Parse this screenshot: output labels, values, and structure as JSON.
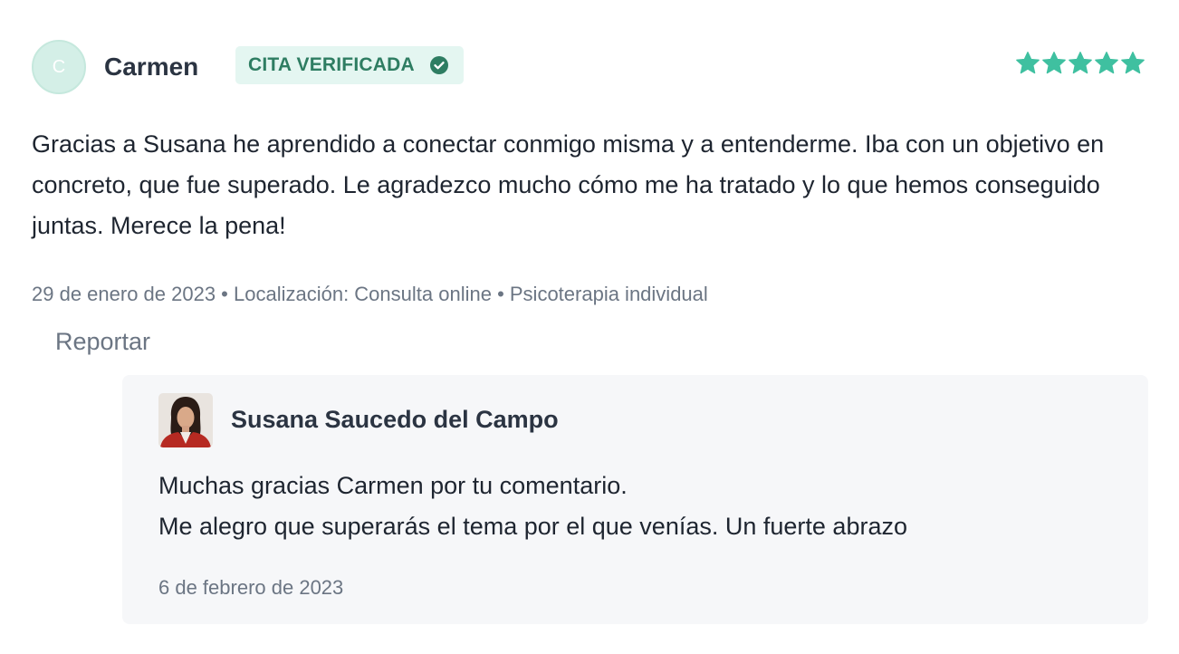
{
  "review": {
    "avatar_initial": "C",
    "author": "Carmen",
    "badge": "CITA VERIFICADA",
    "rating": 5,
    "rating_max": 5,
    "text": "Gracias a Susana he aprendido a conectar conmigo misma y a entenderme. Iba con un objetivo en concreto, que fue superado. Le agradezco mucho cómo me ha tratado y lo que hemos conseguido juntas. Merece la pena!",
    "meta": "29 de enero de 2023 • Localización: Consulta online • Psicoterapia individual",
    "report_label": "Reportar"
  },
  "reply": {
    "author": "Susana Saucedo del Campo",
    "line1": "Muchas gracias Carmen por tu comentario.",
    "line2": "Me alegro que superarás el tema por el que venías. Un fuerte abrazo",
    "date": "6 de febrero de 2023"
  },
  "colors": {
    "accent": "#3fc0a0",
    "badge_bg": "#e4f6f1",
    "badge_text": "#2e7d62",
    "reply_bg": "#f6f7f9",
    "muted_text": "#6b7583"
  },
  "icons": {
    "verified": "check-circle-icon",
    "rating": "star-icon"
  }
}
